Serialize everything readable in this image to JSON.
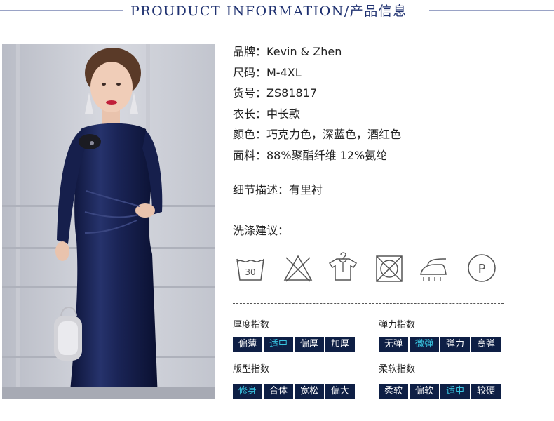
{
  "header": {
    "title": "PROUDUCT INFORMATION/产品信息"
  },
  "photo": {
    "subject": "model in navy velvet dress",
    "dress_color": "#14204f"
  },
  "info": {
    "brand": "品牌：Kevin & Zhen",
    "size": "尺码：M-4XL",
    "item_no": "货号：ZS81817",
    "length": "衣长：中长款",
    "color": "颜色：巧克力色，深蓝色，酒红色",
    "fabric": "面料：88%聚酯纤维 12%氨纶",
    "detail": "细节描述：有里衬",
    "care_title": "洗涤建议："
  },
  "care": {
    "wash_temp": "30",
    "icons": [
      "wash-30-icon",
      "no-bleach-icon",
      "hang-dry-icon",
      "no-tumble-dry-icon",
      "iron-icon",
      "dry-clean-p-icon"
    ],
    "dry_clean_letter": "P"
  },
  "indices": {
    "thickness": {
      "title": "厚度指数",
      "options": [
        "偏薄",
        "适中",
        "偏厚",
        "加厚"
      ],
      "selected": "适中"
    },
    "elasticity": {
      "title": "弹力指数",
      "options": [
        "无弹",
        "微弹",
        "弹力",
        "高弹"
      ],
      "selected": "微弹"
    },
    "fit": {
      "title": "版型指数",
      "options": [
        "修身",
        "合体",
        "宽松",
        "偏大"
      ],
      "selected": "修身"
    },
    "softness": {
      "title": "柔软指数",
      "options": [
        "柔软",
        "偏软",
        "适中",
        "较硬"
      ],
      "selected": "适中"
    }
  },
  "colors": {
    "title": "#1f3170",
    "cell_bg": "#0e1f45",
    "cell_text": "#ffffff",
    "cell_active": "#38c3df"
  }
}
